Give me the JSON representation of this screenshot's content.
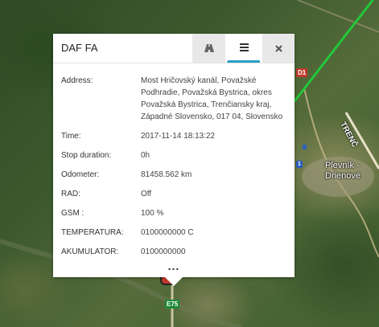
{
  "map": {
    "shields": {
      "d1": "D1",
      "e75": "E75",
      "blue": "1"
    },
    "town_label_line1": "Plevník -",
    "town_label_line2": "Drienové",
    "road_label": "TRENČ"
  },
  "popup": {
    "title": "DAF FA",
    "tabs": [
      {
        "icon": "road-icon",
        "active": false
      },
      {
        "icon": "list-icon",
        "active": true
      },
      {
        "icon": "close-icon",
        "active": false
      }
    ],
    "accent_color": "#2aa0c8",
    "rows": [
      {
        "key": "Address:",
        "value": "Most Hričovský kanál, Považské Podhradie, Považská Bystrica, okres Považská Bystrica, Trenčiansky kraj, Západné Slovensko, 017 04, Slovensko"
      },
      {
        "key": "Time:",
        "value": "2017-11-14 18:13:22"
      },
      {
        "key": "Stop duration:",
        "value": "0h"
      },
      {
        "key": "Odometer:",
        "value": "81458.562 km"
      },
      {
        "key": "RAD:",
        "value": "Off"
      },
      {
        "key": "GSM :",
        "value": "100 %"
      },
      {
        "key": "TEMPERATURA:",
        "value": "0100000000 C"
      },
      {
        "key": "AKUMULATOR:",
        "value": "0100000000"
      }
    ],
    "more_label": "..."
  }
}
